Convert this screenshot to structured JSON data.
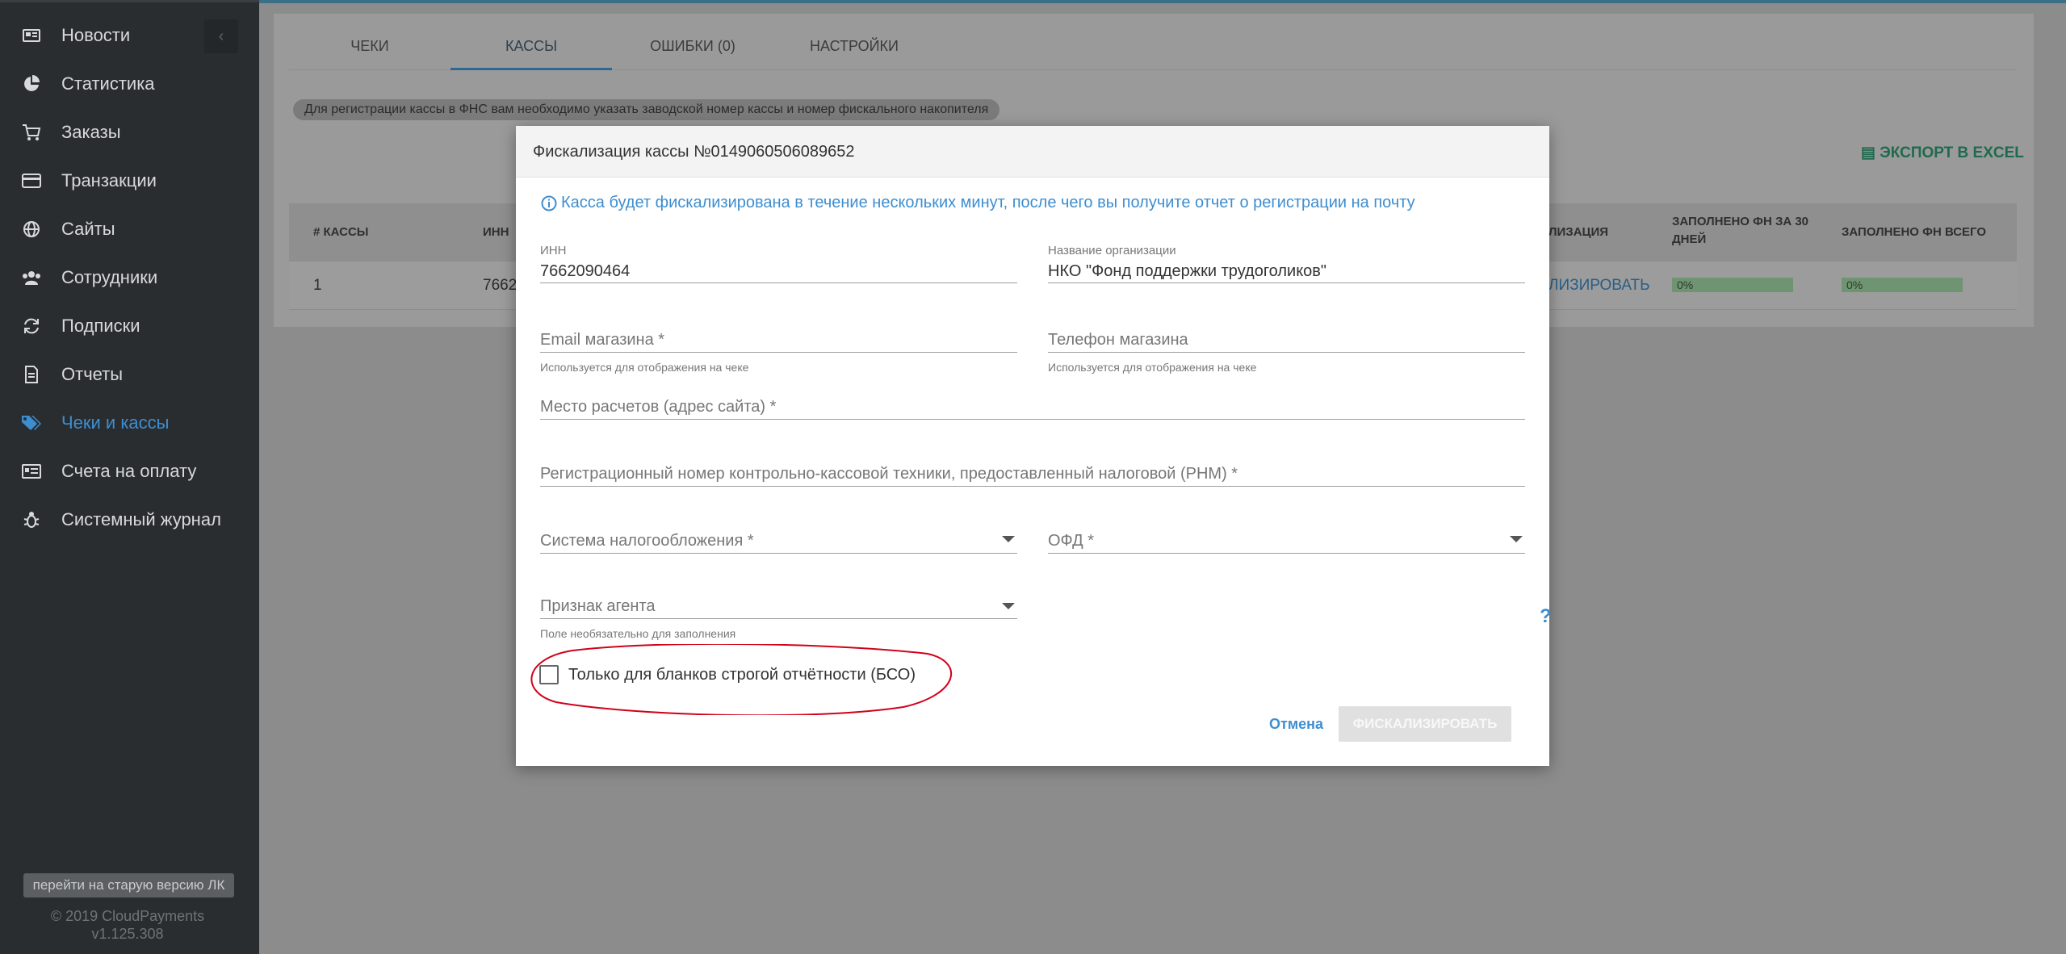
{
  "sidebar": {
    "collapse_icon": "chevron-left-icon",
    "items": [
      {
        "label": "Новости",
        "icon": "newspaper-icon"
      },
      {
        "label": "Статистика",
        "icon": "pie-chart-icon"
      },
      {
        "label": "Заказы",
        "icon": "cart-icon"
      },
      {
        "label": "Транзакции",
        "icon": "credit-card-icon"
      },
      {
        "label": "Сайты",
        "icon": "globe-icon"
      },
      {
        "label": "Сотрудники",
        "icon": "users-icon"
      },
      {
        "label": "Подписки",
        "icon": "refresh-icon"
      },
      {
        "label": "Отчеты",
        "icon": "document-icon"
      },
      {
        "label": "Чеки и кассы",
        "icon": "tags-icon",
        "active": true
      },
      {
        "label": "Счета на оплату",
        "icon": "invoice-icon"
      },
      {
        "label": "Системный журнал",
        "icon": "bug-icon"
      }
    ],
    "old_version": "перейти на старую версию ЛК",
    "copyright": "© 2019 CloudPayments",
    "version": "v1.125.308"
  },
  "main": {
    "tabs": [
      {
        "label": "ЧЕКИ"
      },
      {
        "label": "КАССЫ",
        "active": true
      },
      {
        "label": "ОШИБКИ (0)"
      },
      {
        "label": "НАСТРОЙКИ"
      }
    ],
    "notice": "Для регистрации кассы в ФНС вам необходимо указать заводской номер кассы и номер фискального накопителя",
    "export_label": "ЭКСПОРТ В EXCEL",
    "table": {
      "headers": [
        "# КАССЫ",
        "ИНН",
        "ЛИЗАЦИЯ",
        "ЗАПОЛНЕНО ФН ЗА 30",
        "ДНЕЙ",
        "ЗАПОЛНЕНО ФН ВСЕГО"
      ],
      "row": {
        "num": "1",
        "inn": "7662",
        "action": "ЛИЗИРОВАТЬ",
        "fn_30": "0%",
        "fn_total": "0%"
      }
    }
  },
  "modal": {
    "title": "Фискализация кассы №0149060506089652",
    "info": "Касса будет фискализирована в течение нескольких минут, после чего вы получите отчет о регистрации на почту",
    "inn": {
      "label": "ИНН",
      "value": "7662090464"
    },
    "org": {
      "label": "Название организации",
      "value": "НКО \"Фонд поддержки трудоголиков\""
    },
    "email": {
      "placeholder": "Email магазина *",
      "hint": "Используется для отображения на чеке"
    },
    "phone": {
      "placeholder": "Телефон магазина",
      "hint": "Используется для отображения на чеке"
    },
    "place": {
      "placeholder": "Место расчетов (адрес сайта) *"
    },
    "rnm": {
      "placeholder": "Регистрационный номер контрольно-кассовой техники, предоставленный налоговой (РНМ) *"
    },
    "tax_system": {
      "placeholder": "Система налогообложения *"
    },
    "ofd": {
      "placeholder": "ОФД *"
    },
    "agent": {
      "placeholder": "Признак агента",
      "hint": "Поле необязательно для заполнения"
    },
    "help": "?",
    "bso_label": "Только для бланков строгой отчётности (БСО)",
    "bso_checked": false,
    "cancel": "Отмена",
    "submit": "ФИСКАЛИЗИРОВАТЬ"
  },
  "colors": {
    "accent": "#3d8ed0",
    "sidebar_bg": "#2a2d30",
    "annotation": "#d0021b"
  }
}
